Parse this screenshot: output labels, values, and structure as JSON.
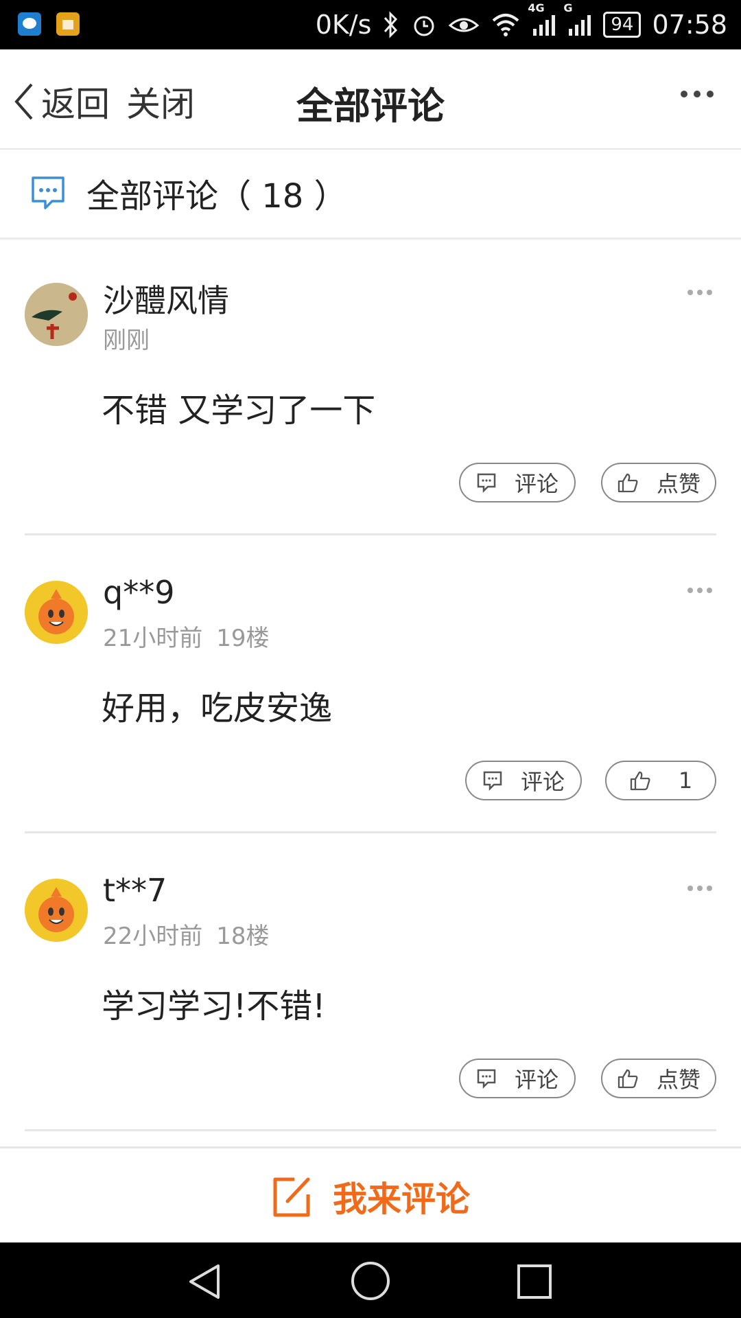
{
  "status_bar": {
    "network_speed": "0K/s",
    "net_4g": "4G",
    "net_g": "G",
    "battery": "94",
    "time": "07:58"
  },
  "nav": {
    "back_label": "返回",
    "close_label": "关闭",
    "title": "全部评论"
  },
  "comments_header": {
    "label": "全部评论（ 18 ）"
  },
  "comments": [
    {
      "username": "沙醴风情",
      "time": "刚刚",
      "floor": "",
      "content": "不错 又学习了一下",
      "comment_label": "评论",
      "like_label": "点赞"
    },
    {
      "username": "q**9",
      "time": "21小时前",
      "floor": "19楼",
      "content": "好用，吃皮安逸",
      "comment_label": "评论",
      "like_label": "1"
    },
    {
      "username": "t**7",
      "time": "22小时前",
      "floor": "18楼",
      "content": "学习学习!不错!",
      "comment_label": "评论",
      "like_label": "点赞"
    }
  ],
  "bottom_bar": {
    "label": "我来评论"
  },
  "colors": {
    "accent": "#f06a1a",
    "icon_blue": "#3a8fdc"
  }
}
